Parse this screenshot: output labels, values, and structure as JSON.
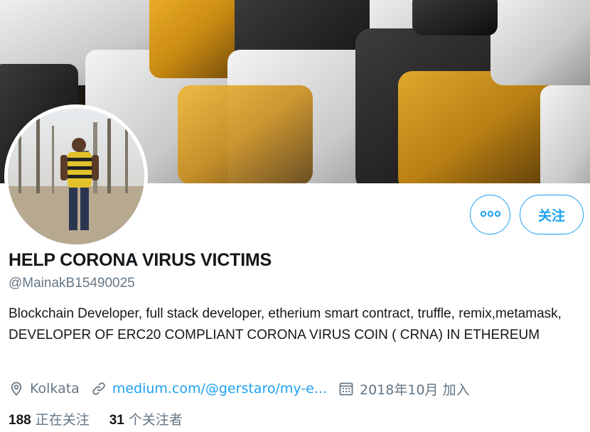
{
  "profile": {
    "display_name": "HELP CORONA VIRUS VICTIMS",
    "handle": "@MainakB15490025",
    "bio": "Blockchain Developer, full stack developer, etherium smart contract, truffle, remix,metamask, DEVELOPER OF ERC20 COMPLIANT CORONA VIRUS COIN ( CRNA) IN ETHEREUM",
    "location": "Kolkata",
    "website": "medium.com/@gerstaro/my-e...",
    "joined": "2018年10月 加入"
  },
  "actions": {
    "more_icon": "ellipsis-icon",
    "follow_label": "关注"
  },
  "stats": {
    "following_count": "188",
    "following_label": "正在关注",
    "followers_count": "31",
    "followers_label": "个关注者"
  },
  "icons": {
    "location": "location-pin-icon",
    "link": "link-icon",
    "calendar": "calendar-icon"
  },
  "colors": {
    "accent": "#1da1f2",
    "secondary_text": "#657786",
    "primary_text": "#14171a"
  }
}
